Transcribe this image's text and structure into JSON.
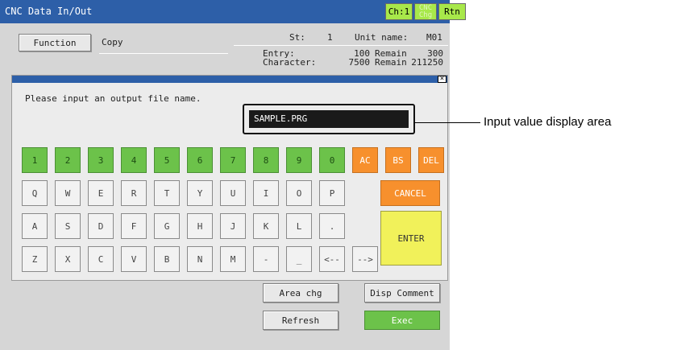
{
  "window": {
    "title": "CNC Data In/Out"
  },
  "title_buttons": {
    "channel": "Ch:1",
    "cnc_chg_line1": "CNC",
    "cnc_chg_line2": "Chg",
    "return": "Rtn"
  },
  "header": {
    "function_button": "Function",
    "function_value": "Copy",
    "st_label": "St:",
    "st_value": "1",
    "unit_label": "Unit name:",
    "unit_value": "M01",
    "entry_label": "Entry:",
    "entry_value": "100",
    "entry_remain_label": "Remain",
    "entry_remain_value": "300",
    "char_label": "Character:",
    "char_value": "7500",
    "char_remain_label": "Remain",
    "char_remain_value": "211250"
  },
  "dialog": {
    "close_symbol": "×",
    "prompt": "Please input an output file name.",
    "input_value": "SAMPLE.PRG",
    "keys_row1": [
      "1",
      "2",
      "3",
      "4",
      "5",
      "6",
      "7",
      "8",
      "9",
      "0"
    ],
    "keys_row2": [
      "Q",
      "W",
      "E",
      "R",
      "T",
      "Y",
      "U",
      "I",
      "O",
      "P"
    ],
    "keys_row3": [
      "A",
      "S",
      "D",
      "F",
      "G",
      "H",
      "J",
      "K",
      "L",
      "."
    ],
    "keys_row4": [
      "Z",
      "X",
      "C",
      "V",
      "B",
      "N",
      "M",
      "-",
      "_",
      "<--",
      "-->"
    ],
    "ac": "AC",
    "bs": "BS",
    "del": "DEL",
    "cancel": "CANCEL",
    "enter": "ENTER"
  },
  "bottom": {
    "area_chg": "Area chg",
    "disp_comment": "Disp Comment",
    "refresh": "Refresh",
    "exec": "Exec"
  },
  "callout": {
    "text": "Input value display area"
  },
  "colors": {
    "title_bar": "#2d5fa8",
    "key_green": "#6cc24a",
    "key_orange": "#f7902d",
    "enter_yellow": "#f1f15a",
    "exec_green": "#6cc24a"
  }
}
